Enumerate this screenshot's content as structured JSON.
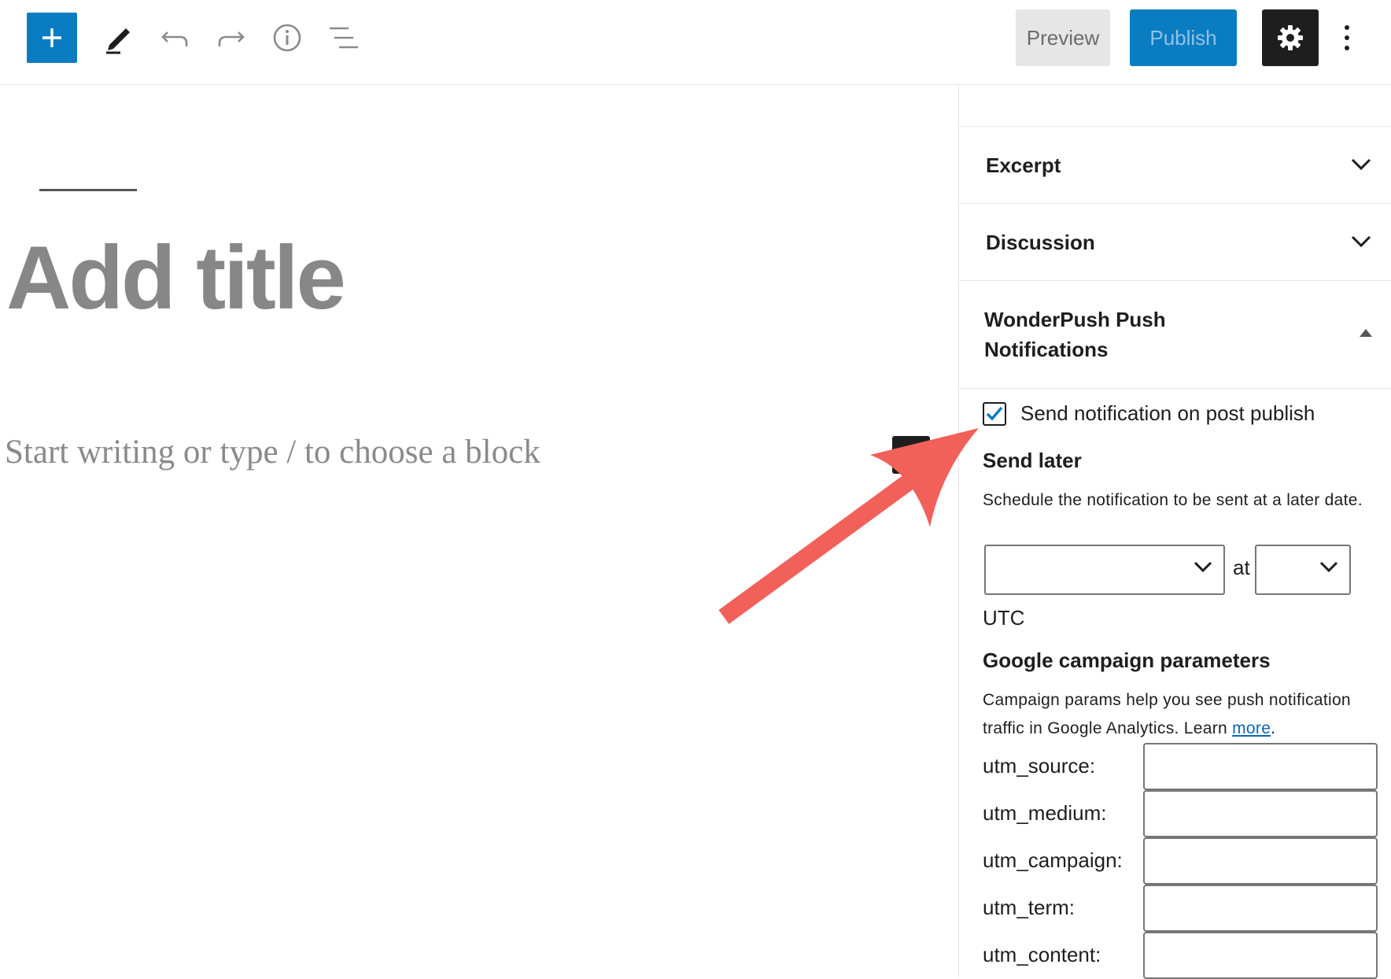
{
  "toolbar": {
    "add_icon": "plus-icon",
    "tools_icon": "pencil-icon",
    "undo_icon": "undo-icon",
    "redo_icon": "redo-icon",
    "info_icon": "info-icon",
    "outline_icon": "list-view-icon",
    "preview_label": "Preview",
    "publish_label": "Publish",
    "settings_icon": "gear-icon",
    "more_icon": "more-vertical-icon"
  },
  "editor": {
    "title_placeholder": "Add title",
    "block_placeholder": "Start writing or type / to choose a block"
  },
  "sidebar": {
    "panels": [
      {
        "label": "Excerpt",
        "expanded": false
      },
      {
        "label": "Discussion",
        "expanded": false
      }
    ],
    "wonderpush": {
      "title": "WonderPush Push Notifications",
      "send_on_publish_label": "Send notification on post publish",
      "send_on_publish_checked": true,
      "send_later_heading": "Send later",
      "send_later_desc": "Schedule the notification to be sent at a later date.",
      "date_value": "",
      "at_label": "at",
      "time_value": "",
      "timezone": "UTC",
      "campaign_heading": "Google campaign parameters",
      "campaign_desc": "Campaign params help you see push notification traffic in Google Analytics. Learn ",
      "campaign_link": "more",
      "campaign_desc_end": ".",
      "utm_fields": [
        {
          "label": "utm_source:",
          "value": ""
        },
        {
          "label": "utm_medium:",
          "value": ""
        },
        {
          "label": "utm_campaign:",
          "value": ""
        },
        {
          "label": "utm_term:",
          "value": ""
        },
        {
          "label": "utm_content:",
          "value": ""
        }
      ]
    }
  },
  "colors": {
    "accent": "#0a7cc1",
    "annotation": "#f2605a"
  }
}
